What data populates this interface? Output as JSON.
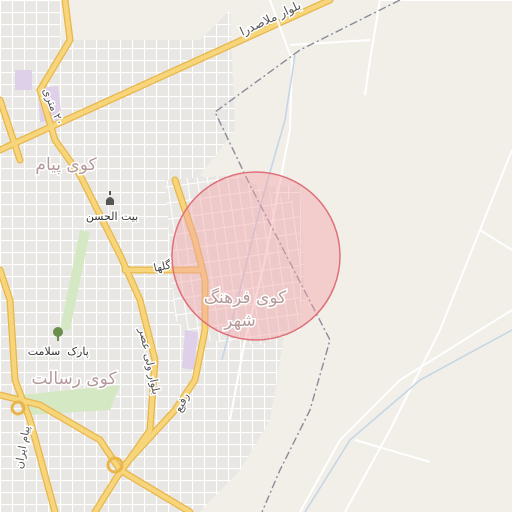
{
  "map": {
    "colors": {
      "background": "#f2efe9",
      "block": "#e9e7e4",
      "street": "#ffffff",
      "arterial": "#f7d57a",
      "arterial_casing": "#e8b64c",
      "park": "#d4e8c4",
      "district_label": "#b49a9a",
      "boundary": "#8a8a99",
      "waterway": "#c5d6e6",
      "highlight_fill": "#f3a3a8",
      "highlight_stroke": "#e0707a"
    },
    "labels": {
      "blvd_mollasadra": "بلوار ملاصدرا",
      "st_20_metri": "۲۰ متری",
      "district_payam": "کوی پیام",
      "bayt_alhasan": "بیت الحسن",
      "st_golha": "گلها",
      "district_farhang": "کوی فرهنگ",
      "district_farhang_2": "شهر",
      "park_salamat_1": "پارک",
      "park_salamat_2": "سلامت",
      "blvd_asr": "بلوار ولی عصر",
      "district_resalat": "کوی رسالت",
      "st_rafie": "رفیع",
      "st_payam_iran": "پیام ایران"
    },
    "icons": {
      "poi": "mosque-icon",
      "park": "tree-icon"
    },
    "highlight": {
      "label": "search-area-circle"
    }
  }
}
